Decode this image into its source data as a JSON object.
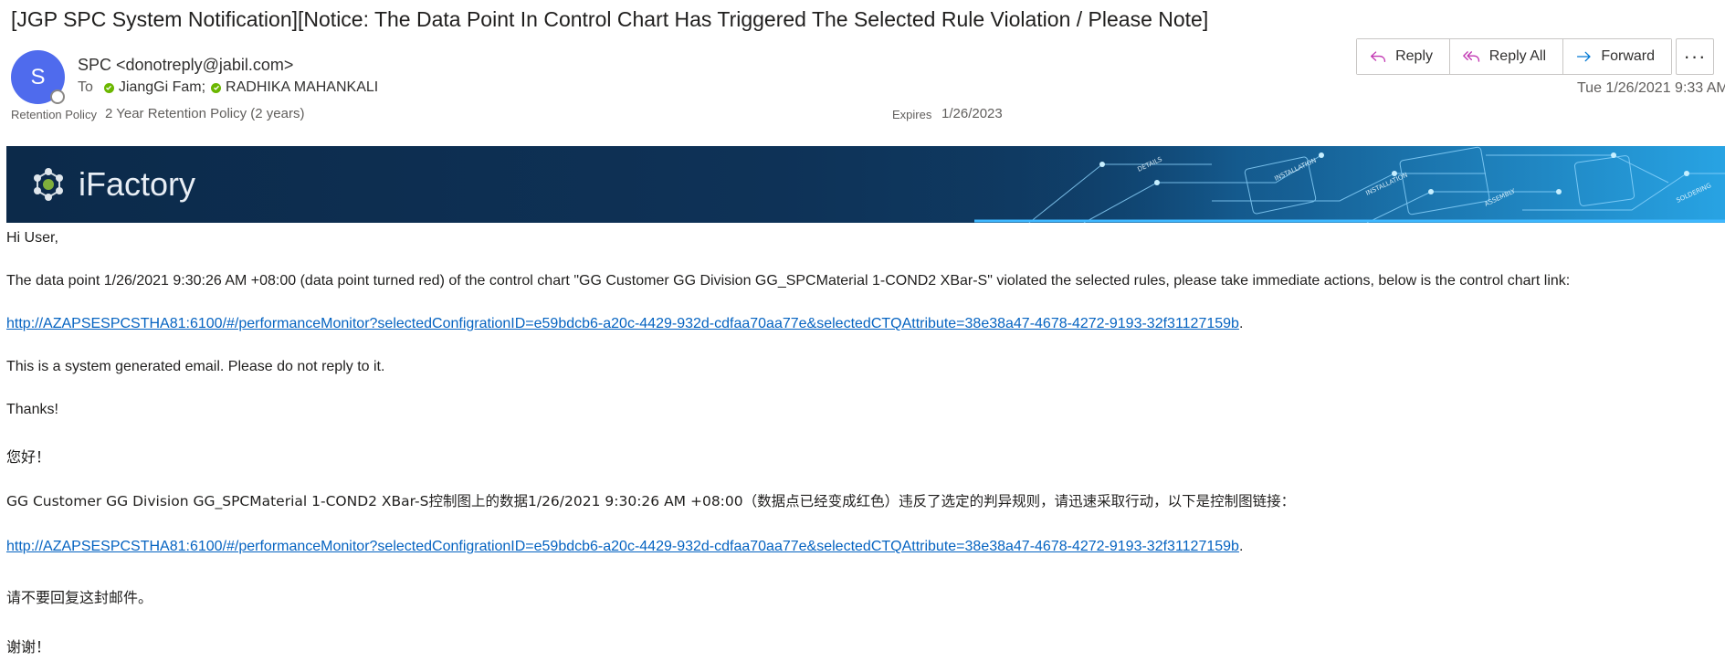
{
  "email": {
    "subject": "[JGP SPC System Notification][Notice: The Data Point In Control Chart Has Triggered The Selected Rule Violation / Please Note]",
    "sender_initial": "S",
    "sender": "SPC <donotreply@jabil.com>",
    "to_label": "To",
    "recipients": [
      "JiangGi Fam;",
      "RADHIKA MAHANKALI"
    ],
    "retention_label": "Retention Policy",
    "retention_value": "2 Year Retention Policy (2 years)",
    "expires_label": "Expires",
    "expires_value": "1/26/2023",
    "date": "Tue 1/26/2021 9:33 AM"
  },
  "actions": {
    "reply": "Reply",
    "reply_all": "Reply All",
    "forward": "Forward",
    "more": "···"
  },
  "banner": {
    "title": "iFactory",
    "art_labels": [
      "DETAILS",
      "INSTALLATION",
      "ASSEMBLY",
      "INSTALLATION",
      "SOLDERING"
    ]
  },
  "body": {
    "greeting_en": "Hi User,",
    "message_en": "The data point 1/26/2021 9:30:26 AM +08:00 (data point turned red) of the control chart \"GG Customer GG Division GG_SPCMaterial 1-COND2 XBar-S\" violated the selected rules, please take immediate actions, below is the control chart link:",
    "link_en": "http://AZAPSESPCSTHA81:6100/#/performanceMonitor?selectedConfigrationID=e59bdcb6-a20c-4429-932d-cdfaa70aa77e&selectedCTQAttribute=38e38a47-4678-4272-9193-32f31127159b",
    "link_suffix": ".",
    "no_reply_en": "This is a system generated email. Please do not reply to it.",
    "thanks_en": "Thanks!",
    "greeting_cn": "您好！",
    "message_cn": "GG Customer GG Division GG_SPCMaterial 1-COND2 XBar-S控制图上的数据1/26/2021 9:30:26 AM +08:00（数据点已经变成红色）违反了选定的判异规则，请迅速采取行动，以下是控制图链接：",
    "link_cn": "http://AZAPSESPCSTHA81:6100/#/performanceMonitor?selectedConfigrationID=e59bdcb6-a20c-4429-932d-cdfaa70aa77e&selectedCTQAttribute=38e38a47-4678-4272-9193-32f31127159b",
    "no_reply_cn": "请不要回复这封邮件。",
    "thanks_cn": "谢谢！"
  },
  "colors": {
    "avatar": "#4f6bed",
    "presence": "#6bb700",
    "link": "#0563c1",
    "banner_dark": "#0c2a4a",
    "action_icon": "#c239b3",
    "forward_icon": "#0078d4"
  },
  "icons": [
    "reply-icon",
    "reply-all-icon",
    "forward-icon",
    "more-icon",
    "presence-available-icon",
    "ifactory-logo-icon"
  ]
}
